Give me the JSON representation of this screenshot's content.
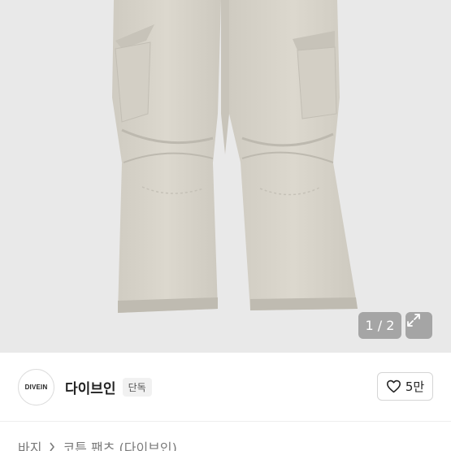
{
  "gallery": {
    "counter": "1 / 2",
    "expand_icon": "expand-arrows-icon"
  },
  "seller": {
    "avatar_text": "DIVEIN",
    "name": "다이브인",
    "badge": "단독"
  },
  "like": {
    "icon": "heart-outline-icon",
    "count": "5만"
  },
  "breadcrumb": {
    "category": "바지",
    "product": "코튼 팬츠 (다이브인)",
    "separator_icon": "chevron-right-icon"
  },
  "colors": {
    "photo_bg": "#e9e9e9",
    "pants": "#d6d2c8",
    "text_primary": "#222222",
    "text_secondary": "#7a7a7a"
  }
}
